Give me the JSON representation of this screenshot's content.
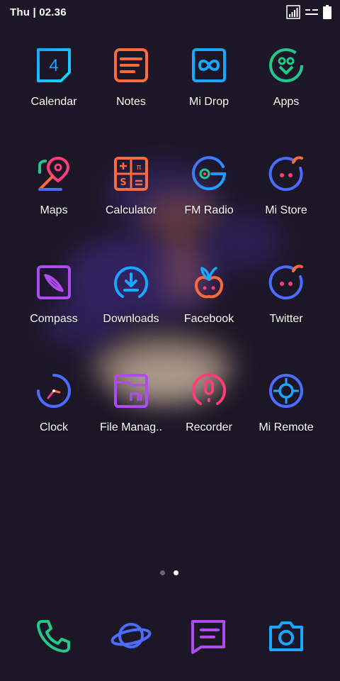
{
  "status_bar": {
    "time": "Thu | 02.36"
  },
  "apps": [
    {
      "label": "Calendar",
      "icon": "calendar-icon",
      "day": "4"
    },
    {
      "label": "Notes",
      "icon": "notes-icon"
    },
    {
      "label": "Mi Drop",
      "icon": "mi-drop-icon"
    },
    {
      "label": "Apps",
      "icon": "apps-icon"
    },
    {
      "label": "Maps",
      "icon": "maps-icon"
    },
    {
      "label": "Calculator",
      "icon": "calculator-icon"
    },
    {
      "label": "FM Radio",
      "icon": "fm-radio-icon"
    },
    {
      "label": "Mi Store",
      "icon": "mi-store-icon"
    },
    {
      "label": "Compass",
      "icon": "compass-icon"
    },
    {
      "label": "Downloads",
      "icon": "downloads-icon"
    },
    {
      "label": "Facebook",
      "icon": "facebook-icon"
    },
    {
      "label": "Twitter",
      "icon": "twitter-icon"
    },
    {
      "label": "Clock",
      "icon": "clock-icon"
    },
    {
      "label": "File Manag..",
      "icon": "file-manager-icon"
    },
    {
      "label": "Recorder",
      "icon": "recorder-icon"
    },
    {
      "label": "Mi Remote",
      "icon": "mi-remote-icon"
    }
  ],
  "page_indicator": {
    "count": 2,
    "active": 2
  },
  "dock": [
    {
      "icon": "phone-icon"
    },
    {
      "icon": "browser-icon"
    },
    {
      "icon": "messages-icon"
    },
    {
      "icon": "camera-icon"
    }
  ],
  "colors": {
    "background": "#1c1727",
    "blue": "#1fa8f0",
    "orange": "#ff6a3d",
    "green": "#22c98a",
    "purple": "#b04bf0",
    "indigo": "#4c6cff",
    "pink": "#ff3d7a"
  }
}
